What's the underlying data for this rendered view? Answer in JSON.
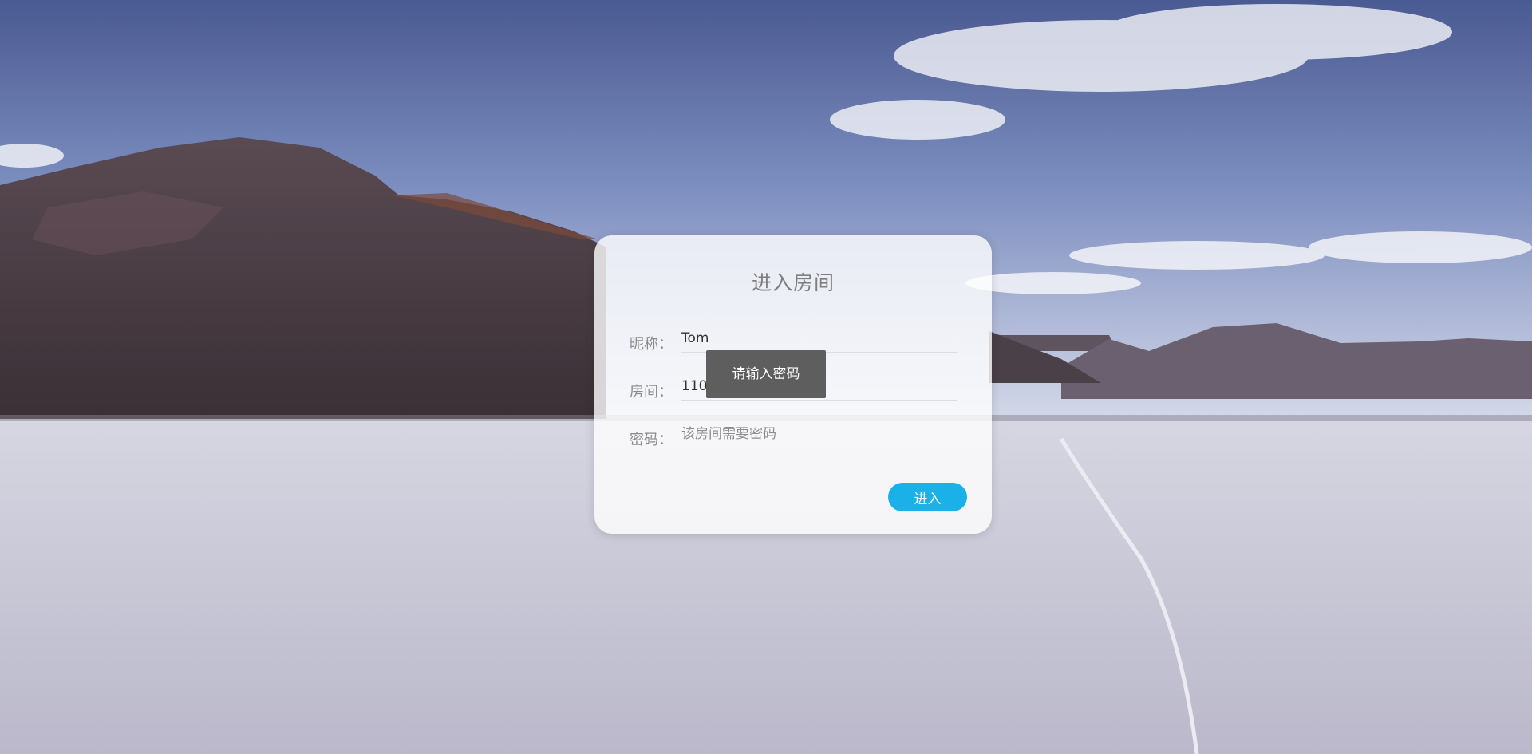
{
  "login": {
    "title": "进入房间",
    "nickname_label": "昵称：",
    "nickname_value": "Tom",
    "room_label": "房间：",
    "room_value": "110",
    "password_label": "密码：",
    "password_placeholder": "该房间需要密码",
    "enter_label": "进入"
  },
  "toast": {
    "message": "请输入密码"
  },
  "colors": {
    "button": "#1ab0e8",
    "toast_bg": "#555555"
  }
}
